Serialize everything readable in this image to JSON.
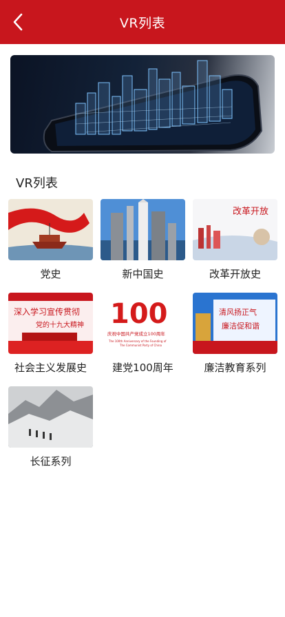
{
  "header": {
    "title": "VR列表",
    "back_icon": "chevron-left-icon",
    "background": "#c8161d"
  },
  "banner": {
    "description": "city-hologram-phone"
  },
  "section": {
    "title": "VR列表"
  },
  "items": [
    {
      "label": "党史"
    },
    {
      "label": "新中国史"
    },
    {
      "label": "改革开放史",
      "image_text": "改革开放"
    },
    {
      "label": "社会主义发展史",
      "image_text_1": "深入学习宣传贯彻",
      "image_text_2": "党的十九大精神"
    },
    {
      "label": "建党100周年",
      "image_text_1": "庆祝中国共产党成立100周年",
      "image_text_2": "The 100th Anniversary of the Founding of",
      "image_text_3": "The Communist Party of China"
    },
    {
      "label": "廉洁教育系列",
      "image_text_1": "清风扬正气",
      "image_text_2": "廉洁促和谐"
    },
    {
      "label": "长征系列"
    }
  ]
}
